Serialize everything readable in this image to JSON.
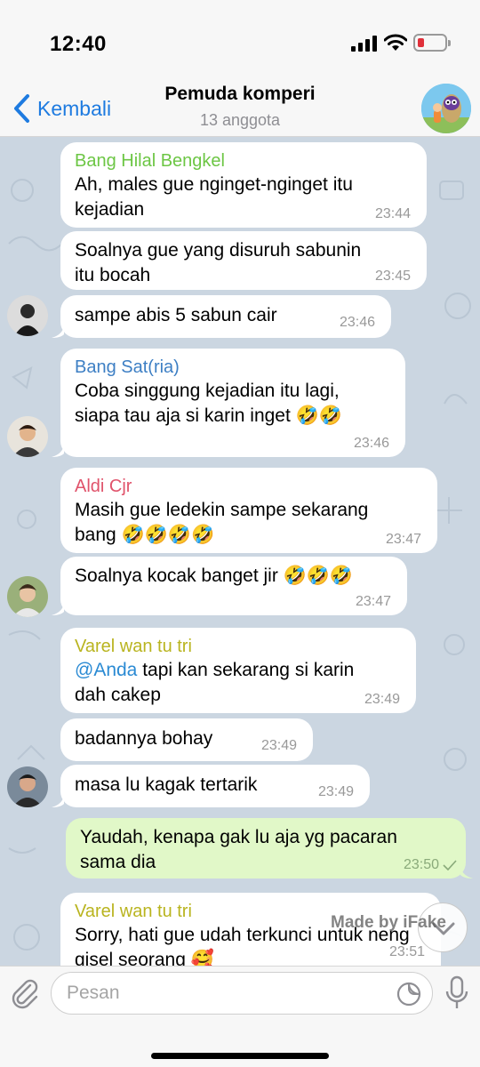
{
  "status_bar": {
    "time": "12:40"
  },
  "header": {
    "back_label": "Kembali",
    "title": "Pemuda komperi",
    "subtitle": "13 anggota"
  },
  "colors": {
    "chat_bg": "#cbd6e1",
    "accent": "#1e7be0",
    "outgoing_bubble": "#e1f8c8",
    "sender_green": "#6cc644",
    "sender_blue": "#3d7fc4",
    "sender_red": "#e0536b",
    "sender_yellow": "#b9b41f"
  },
  "messages": [
    {
      "sender": "Bang Hilal Bengkel",
      "text": "Ah, males gue nginget-nginget itu kejadian",
      "time": "23:44"
    },
    {
      "text": "Soalnya gue yang disuruh sabunin itu bocah",
      "time": "23:45"
    },
    {
      "text": "sampe abis 5 sabun cair",
      "time": "23:46"
    },
    {
      "sender": "Bang Sat(ria)",
      "text": "Coba singgung kejadian itu lagi, siapa tau aja si karin inget 🤣🤣",
      "time": "23:46"
    },
    {
      "sender": "Aldi Cjr",
      "text": "Masih gue ledekin sampe sekarang bang 🤣🤣🤣🤣",
      "time": "23:47"
    },
    {
      "text": "Soalnya kocak banget jir 🤣🤣🤣",
      "time": "23:47"
    },
    {
      "sender": "Varel wan tu tri",
      "mention": "@Anda",
      "text": " tapi kan sekarang si karin dah cakep",
      "time": "23:49"
    },
    {
      "text": "badannya bohay",
      "time": "23:49"
    },
    {
      "text": "masa lu kagak tertarik",
      "time": "23:49"
    },
    {
      "outgoing": true,
      "text": "Yaudah, kenapa gak lu aja yg pacaran sama dia",
      "time": "23:50"
    },
    {
      "sender": "Varel wan tu tri",
      "text": "Sorry, hati gue udah terkunci untuk neng gisel seorang 🥰",
      "time": "23:51"
    }
  ],
  "watermark": "Made by iFake",
  "input": {
    "placeholder": "Pesan",
    "value": ""
  },
  "icons": {
    "back": "chevron-left-icon",
    "attach": "paperclip-icon",
    "sticker": "sticker-icon",
    "mic": "microphone-icon",
    "scroll_down": "chevron-down-icon",
    "read": "check-icon"
  }
}
